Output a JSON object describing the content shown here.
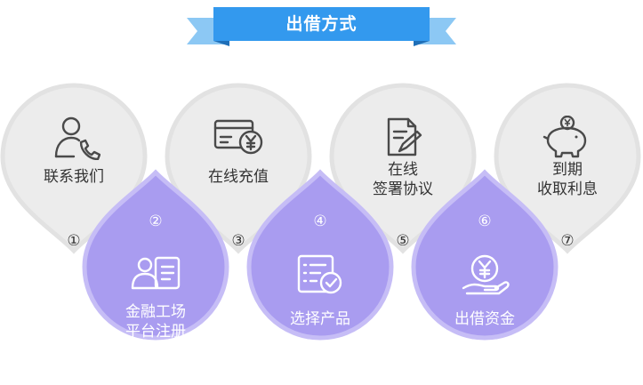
{
  "title": "出借方式",
  "colors": {
    "banner_main": "#3399ee",
    "banner_tail": "#8cc8f4",
    "up_fill": "#ececec",
    "up_ring": "#e2e2e2",
    "down_fill": "#a99cf0",
    "down_ring": "#c6bdf6",
    "up_icon": "#4a4a4a"
  },
  "steps": [
    {
      "number": "①",
      "lines": [
        "联系我们"
      ],
      "icon": "phone-contact-icon"
    },
    {
      "number": "②",
      "lines": [
        "金融工场",
        "平台注册"
      ],
      "icon": "id-card-icon"
    },
    {
      "number": "③",
      "lines": [
        "在线充值"
      ],
      "icon": "bank-card-yuan-icon"
    },
    {
      "number": "④",
      "lines": [
        "选择产品"
      ],
      "icon": "checklist-icon"
    },
    {
      "number": "⑤",
      "lines": [
        "在线",
        "签署协议"
      ],
      "icon": "document-sign-icon"
    },
    {
      "number": "⑥",
      "lines": [
        "出借资金"
      ],
      "icon": "coin-hand-icon"
    },
    {
      "number": "⑦",
      "lines": [
        "到期",
        "收取利息"
      ],
      "icon": "piggy-bank-icon"
    }
  ]
}
